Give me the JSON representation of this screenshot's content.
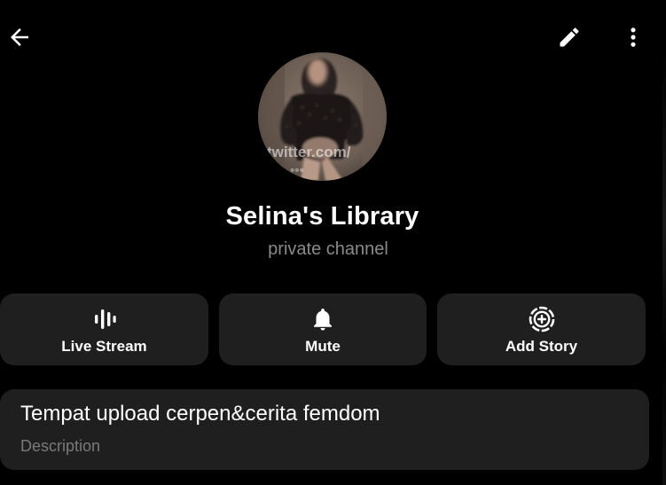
{
  "topbar": {
    "back_icon": "arrow-left-icon",
    "edit_icon": "pencil-icon",
    "more_icon": "more-vertical-icon"
  },
  "channel": {
    "title": "Selina's Library",
    "subtitle": "private channel",
    "avatar_watermark": "twitter.com/"
  },
  "actions": [
    {
      "label": "Live Stream",
      "icon": "live-stream-icon"
    },
    {
      "label": "Mute",
      "icon": "bell-icon"
    },
    {
      "label": "Add Story",
      "icon": "add-story-icon"
    }
  ],
  "description": {
    "text": "Tempat upload cerpen&cerita femdom",
    "label": "Description"
  },
  "colors": {
    "background": "#000000",
    "card": "#1f1f1f",
    "text_primary": "#ffffff",
    "text_secondary": "#8a8a8a"
  }
}
